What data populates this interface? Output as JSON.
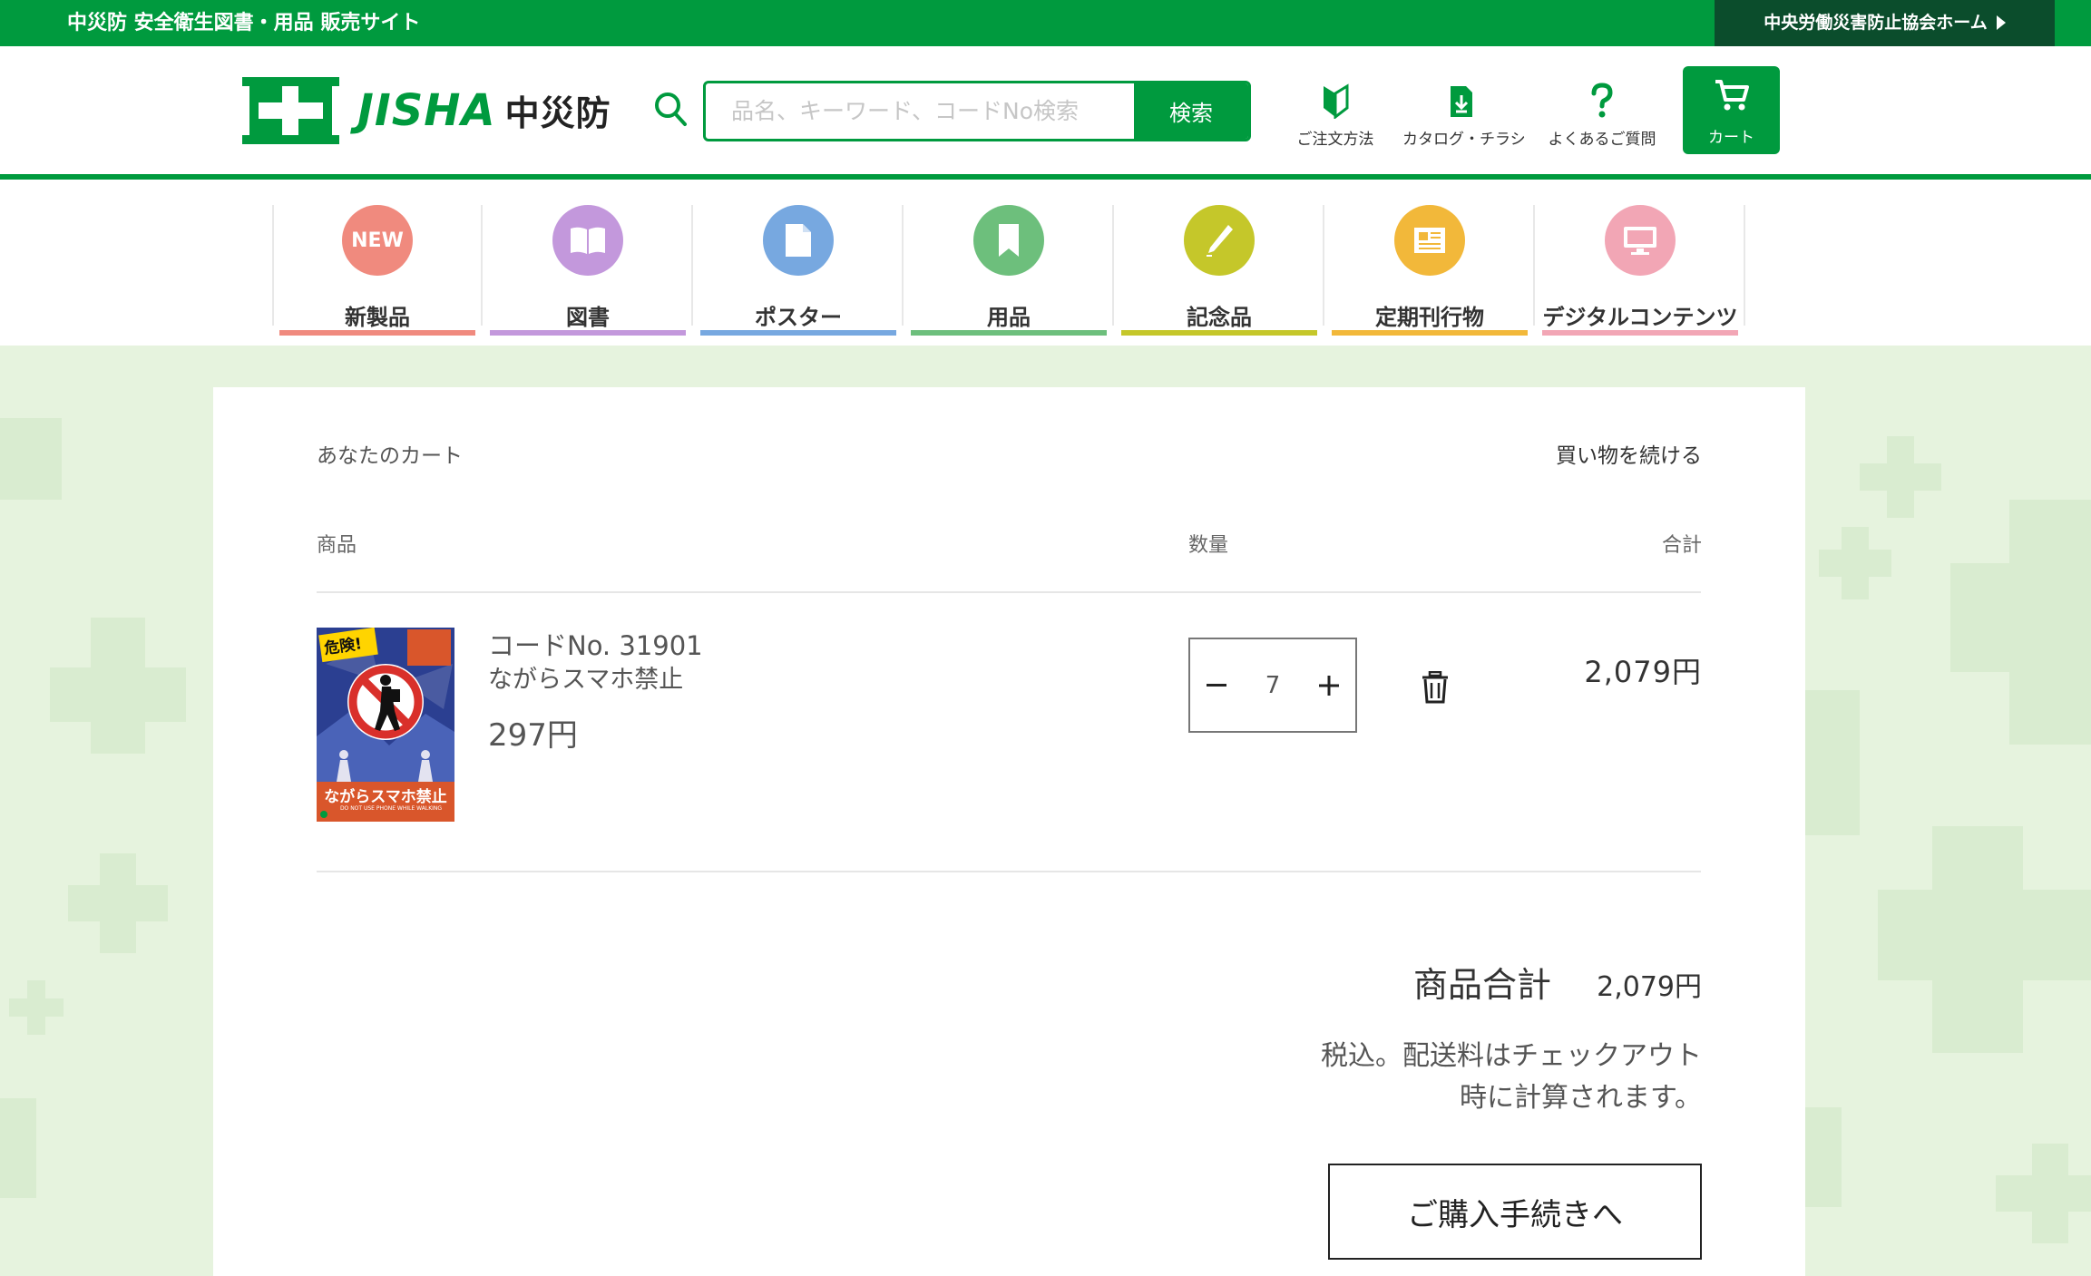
{
  "topbar": {
    "site_name": "中災防 安全衛生図書・用品 販売サイト",
    "assoc_link": "中央労働災害防止協会ホーム"
  },
  "header": {
    "logo_text": "JISHA",
    "logo_kanji": "中災防",
    "search_placeholder": "品名、キーワード、コードNo検索",
    "search_button": "検索",
    "utils": [
      {
        "label": "ご注文方法",
        "icon": "beginner-mark-icon"
      },
      {
        "label": "カタログ・チラシ",
        "icon": "download-icon"
      },
      {
        "label": "よくあるご質問",
        "icon": "question-icon"
      }
    ],
    "cart_label": "カート"
  },
  "categories": [
    {
      "label": "新製品",
      "badge": "NEW",
      "color": "#f08a7e",
      "icon": "new-badge-icon"
    },
    {
      "label": "図書",
      "color": "#c398dc",
      "icon": "book-icon"
    },
    {
      "label": "ポスター",
      "color": "#77a8e0",
      "icon": "document-icon"
    },
    {
      "label": "用品",
      "color": "#6dbf7c",
      "icon": "bookmark-icon"
    },
    {
      "label": "記念品",
      "color": "#c5c72a",
      "icon": "pen-icon"
    },
    {
      "label": "定期刊行物",
      "color": "#f2b83a",
      "icon": "newspaper-icon"
    },
    {
      "label": "デジタルコンテンツ",
      "color": "#f2a6b5",
      "icon": "monitor-icon"
    }
  ],
  "cart": {
    "title": "あなたのカート",
    "continue_label": "買い物を続ける",
    "col_product": "商品",
    "col_qty": "数量",
    "col_total": "合計",
    "item": {
      "code": "コードNo. 31901",
      "name": "ながらスマホ禁止",
      "price": "297円",
      "quantity": "7",
      "line_total": "2,079円",
      "thumb_top_text": "危険!",
      "thumb_bottom_text": "ながらスマホ禁止",
      "thumb_sub_text": "DO NOT USE PHONE WHILE WALKING"
    },
    "subtotal_label": "商品合計",
    "subtotal_value": "2,079円",
    "tax_note_line1": "税込。配送料はチェックアウト",
    "tax_note_line2": "時に計算されます。",
    "checkout_label": "ご購入手続きへ"
  },
  "colors": {
    "brand_green": "#009a3e",
    "dark_green": "#0b4d2c",
    "background_band": "#e6f3de"
  }
}
